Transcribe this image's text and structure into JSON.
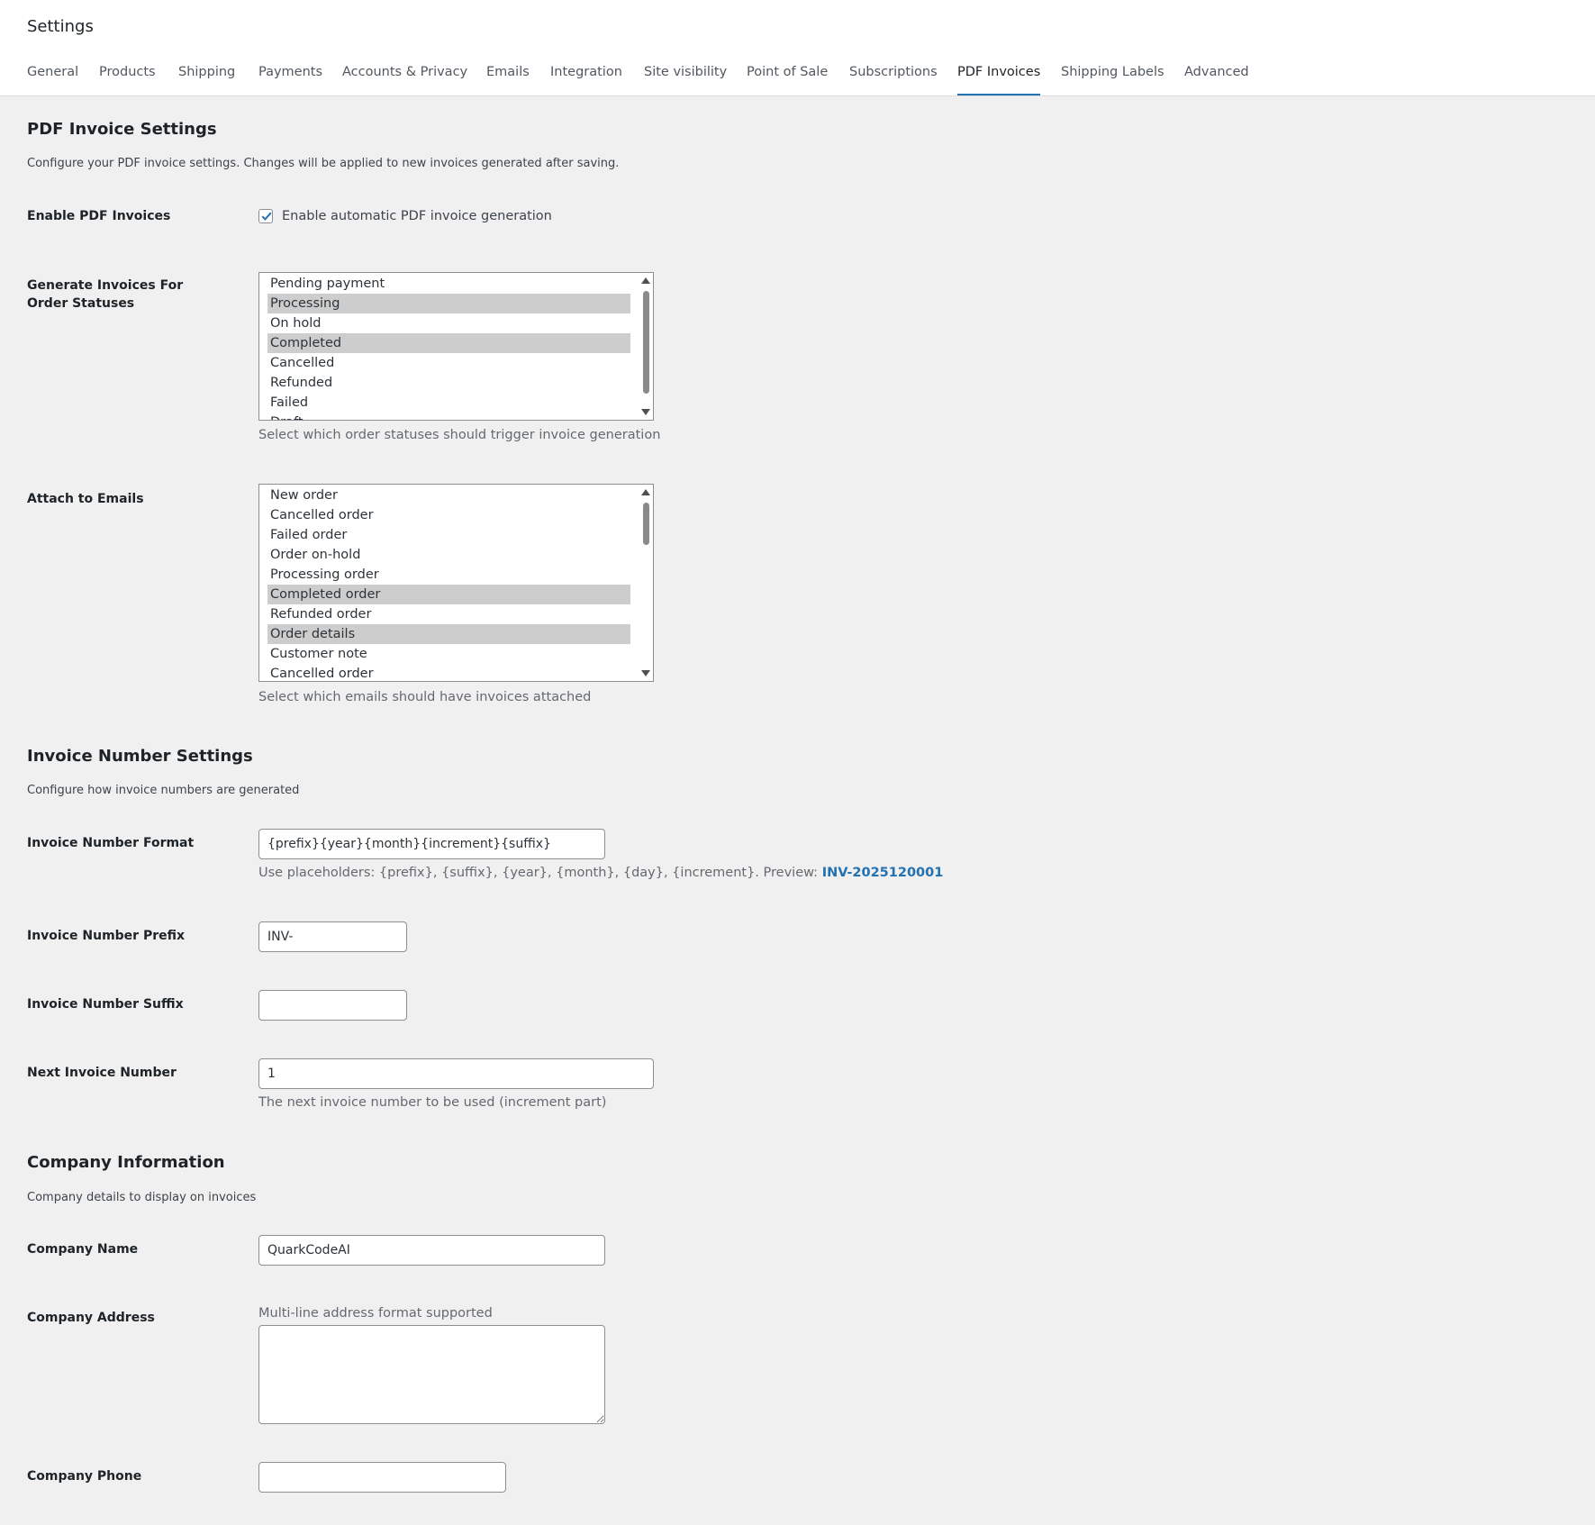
{
  "header": {
    "title": "Settings",
    "tabs": [
      {
        "label": "General"
      },
      {
        "label": "Products"
      },
      {
        "label": "Shipping"
      },
      {
        "label": "Payments"
      },
      {
        "label": "Accounts & Privacy"
      },
      {
        "label": "Emails"
      },
      {
        "label": "Integration"
      },
      {
        "label": "Site visibility"
      },
      {
        "label": "Point of Sale"
      },
      {
        "label": "Subscriptions"
      },
      {
        "label": "PDF Invoices"
      },
      {
        "label": "Shipping Labels"
      },
      {
        "label": "Advanced"
      }
    ],
    "active_tab": "PDF Invoices"
  },
  "pdf_settings": {
    "title": "PDF Invoice Settings",
    "description": "Configure your PDF invoice settings. Changes will be applied to new invoices generated after saving.",
    "enable": {
      "label": "Enable PDF Invoices",
      "checkbox_label": "Enable automatic PDF invoice generation",
      "checked": true
    },
    "order_statuses": {
      "label": "Generate Invoices For Order Statuses",
      "options": [
        {
          "label": "Pending payment",
          "selected": false
        },
        {
          "label": "Processing",
          "selected": true
        },
        {
          "label": "On hold",
          "selected": false
        },
        {
          "label": "Completed",
          "selected": true
        },
        {
          "label": "Cancelled",
          "selected": false
        },
        {
          "label": "Refunded",
          "selected": false
        },
        {
          "label": "Failed",
          "selected": false
        },
        {
          "label": "Draft",
          "selected": false
        }
      ],
      "hint": "Select which order statuses should trigger invoice generation"
    },
    "attach_emails": {
      "label": "Attach to Emails",
      "options": [
        {
          "label": "New order",
          "selected": false
        },
        {
          "label": "Cancelled order",
          "selected": false
        },
        {
          "label": "Failed order",
          "selected": false
        },
        {
          "label": "Order on-hold",
          "selected": false
        },
        {
          "label": "Processing order",
          "selected": false
        },
        {
          "label": "Completed order",
          "selected": true
        },
        {
          "label": "Refunded order",
          "selected": false
        },
        {
          "label": "Order details",
          "selected": true
        },
        {
          "label": "Customer note",
          "selected": false
        },
        {
          "label": "Cancelled order",
          "selected": false
        }
      ],
      "hint": "Select which emails should have invoices attached"
    }
  },
  "number_settings": {
    "title": "Invoice Number Settings",
    "description": "Configure how invoice numbers are generated",
    "format": {
      "label": "Invoice Number Format",
      "value": "{prefix}{year}{month}{increment}{suffix}",
      "hint": "Use placeholders: {prefix}, {suffix}, {year}, {month}, {day}, {increment}. Preview: ",
      "preview": "INV-2025120001"
    },
    "prefix": {
      "label": "Invoice Number Prefix",
      "value": "INV-"
    },
    "suffix": {
      "label": "Invoice Number Suffix",
      "value": ""
    },
    "next_number": {
      "label": "Next Invoice Number",
      "value": "1",
      "hint": "The next invoice number to be used (increment part)"
    }
  },
  "company": {
    "title": "Company Information",
    "description": "Company details to display on invoices",
    "name": {
      "label": "Company Name",
      "value": "QuarkCodeAI"
    },
    "address": {
      "label": "Company Address",
      "hint": "Multi-line address format supported",
      "value": ""
    },
    "phone": {
      "label": "Company Phone",
      "value": ""
    }
  },
  "colors": {
    "accent": "#2271b1",
    "background": "#f0f0f1",
    "selected_option": "#cdcdcd"
  }
}
